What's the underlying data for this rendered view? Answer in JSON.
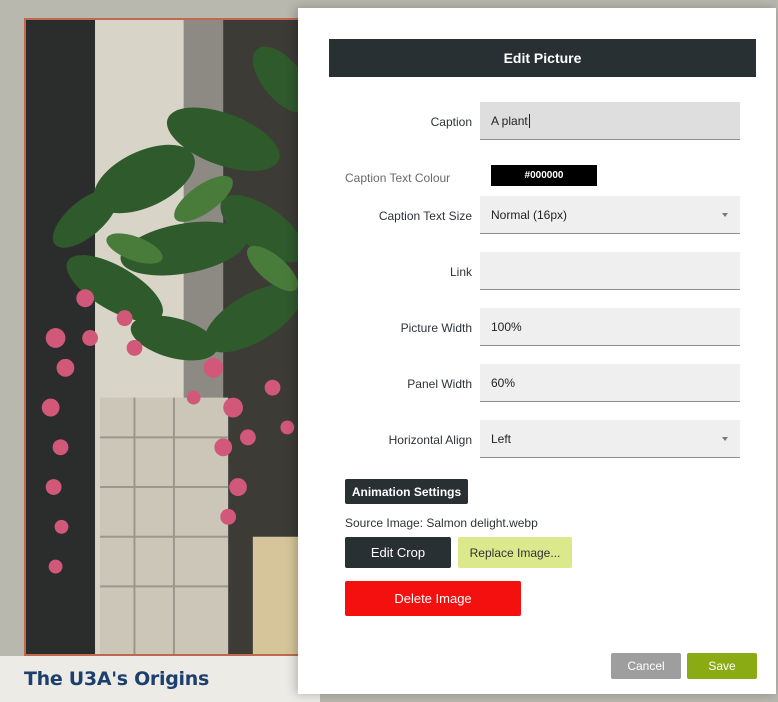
{
  "background": {
    "heading": "The U3A's Origins"
  },
  "dialog": {
    "title": "Edit Picture",
    "caption": {
      "label": "Caption",
      "value": "A plant"
    },
    "caption_colour": {
      "label": "Caption Text Colour",
      "value": "#000000"
    },
    "caption_size": {
      "label": "Caption Text Size",
      "value": "Normal (16px)"
    },
    "link": {
      "label": "Link",
      "value": ""
    },
    "picture_width": {
      "label": "Picture Width",
      "value": "100%"
    },
    "panel_width": {
      "label": "Panel Width",
      "value": "60%"
    },
    "horizontal_align": {
      "label": "Horizontal Align",
      "value": "Left"
    },
    "animation_button": "Animation Settings",
    "source_image": "Source Image: Salmon delight.webp",
    "edit_crop_button": "Edit Crop",
    "replace_image_button": "Replace Image...",
    "delete_image_button": "Delete Image",
    "cancel_button": "Cancel",
    "save_button": "Save"
  },
  "colors": {
    "header_bg": "#283034",
    "delete_red": "#f51010",
    "save_green": "#8bab14",
    "replace_yellow": "#dbe88c",
    "frame_border": "#c0694f",
    "heading_blue": "#1d3f6e"
  }
}
